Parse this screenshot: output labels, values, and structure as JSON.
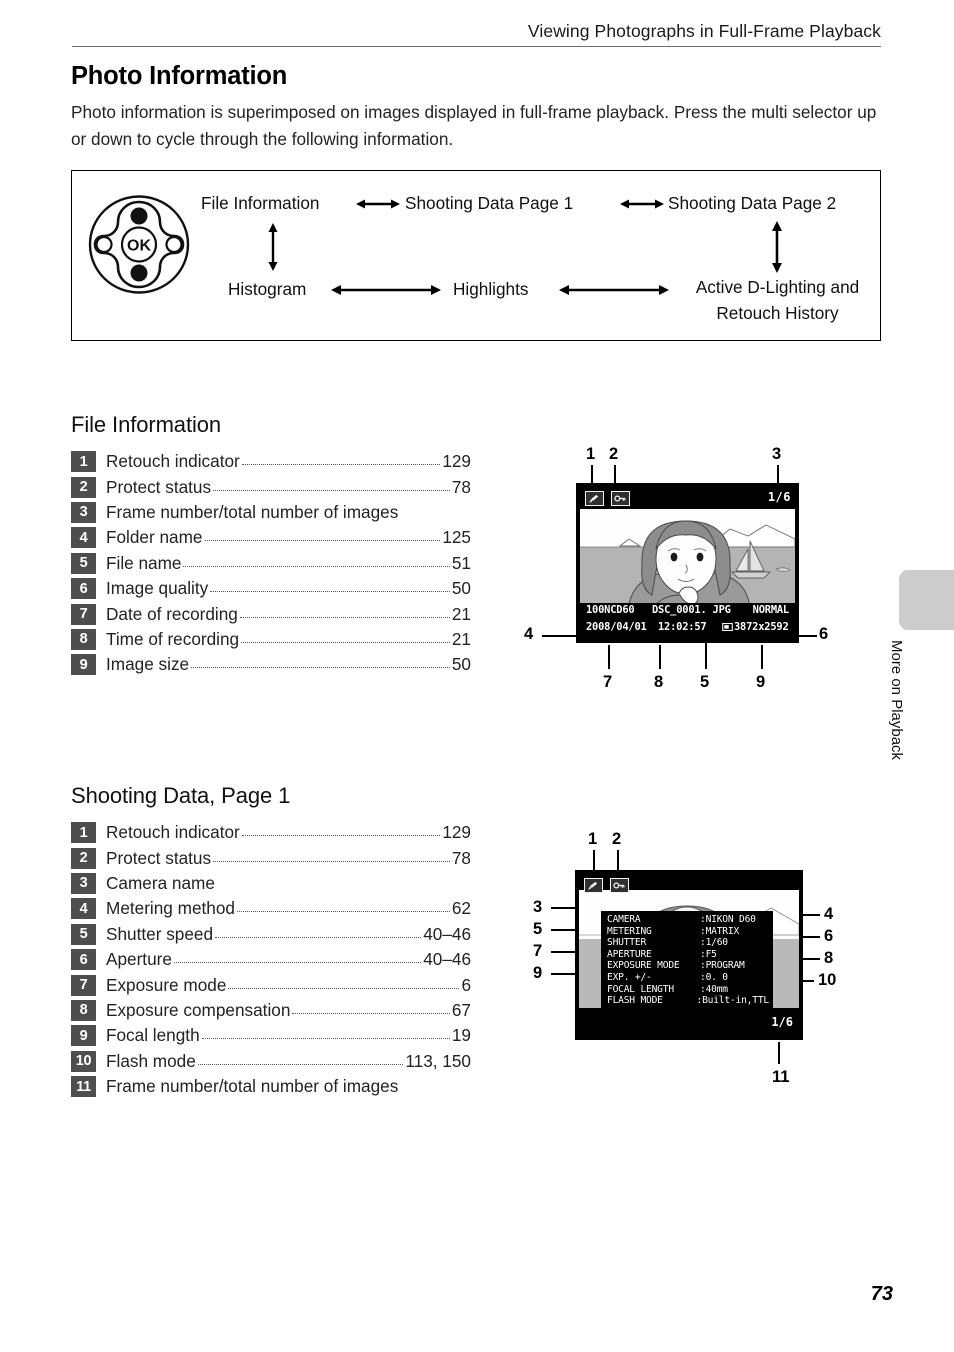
{
  "header": {
    "running_title": "Viewing Photographs in Full-Frame Playback"
  },
  "page": {
    "title": "Photo Information",
    "intro": "Photo information is superimposed on images displayed in full-frame playback. Press the multi selector up or down to cycle through the following information.",
    "number": "73"
  },
  "side_tab": {
    "label": "More on Playback"
  },
  "flow_diagram": {
    "multi_selector_ok_label": "OK",
    "nodes": {
      "file_information": "File Information",
      "shooting_data_1": "Shooting Data Page 1",
      "shooting_data_2": "Shooting Data Page 2",
      "histogram": "Histogram",
      "highlights": "Highlights",
      "active_d_lighting": "Active D-Lighting and Retouch History"
    }
  },
  "file_information": {
    "heading": "File Information",
    "items": [
      {
        "num": "1",
        "label": "Retouch indicator",
        "page": "129"
      },
      {
        "num": "2",
        "label": "Protect status",
        "page": "78"
      },
      {
        "num": "3",
        "label": "Frame number/total number of images",
        "page": ""
      },
      {
        "num": "4",
        "label": "Folder name",
        "page": "125"
      },
      {
        "num": "5",
        "label": "File name",
        "page": "51"
      },
      {
        "num": "6",
        "label": "Image quality",
        "page": "50"
      },
      {
        "num": "7",
        "label": "Date of recording",
        "page": "21"
      },
      {
        "num": "8",
        "label": "Time of recording",
        "page": "21"
      },
      {
        "num": "9",
        "label": "Image size",
        "page": "50"
      }
    ],
    "screen": {
      "frame_counter": "1/6",
      "folder_name": "100NCD60",
      "file_name": "DSC_0001. JPG",
      "quality": "NORMAL",
      "date": "2008/04/01",
      "time": "12:02:57",
      "image_size": "3872x2592",
      "callouts": [
        "1",
        "2",
        "3",
        "4",
        "5",
        "6",
        "7",
        "8",
        "9"
      ]
    }
  },
  "shooting_data": {
    "heading": "Shooting Data, Page 1",
    "items": [
      {
        "num": "1",
        "label": "Retouch indicator",
        "page": "129"
      },
      {
        "num": "2",
        "label": "Protect status",
        "page": "78"
      },
      {
        "num": "3",
        "label": "Camera name",
        "page": ""
      },
      {
        "num": "4",
        "label": "Metering method",
        "page": "62"
      },
      {
        "num": "5",
        "label": "Shutter speed",
        "page": "40–46"
      },
      {
        "num": "6",
        "label": "Aperture",
        "page": "40–46"
      },
      {
        "num": "7",
        "label": "Exposure mode",
        "page": "6"
      },
      {
        "num": "8",
        "label": "Exposure compensation",
        "page": "67"
      },
      {
        "num": "9",
        "label": "Focal length",
        "page": "19"
      },
      {
        "num": "10",
        "label": "Flash mode",
        "page": "113, 150"
      },
      {
        "num": "11",
        "label": "Frame number/total number of images",
        "page": ""
      }
    ],
    "screen": {
      "frame_counter": "1/6",
      "rows": [
        {
          "key": "CAMERA",
          "value": ":NIKON D60"
        },
        {
          "key": "METERING",
          "value": ":MATRIX"
        },
        {
          "key": "SHUTTER",
          "value": ":1/60"
        },
        {
          "key": "APERTURE",
          "value": ":F5"
        },
        {
          "key": "EXPOSURE MODE",
          "value": ":PROGRAM"
        },
        {
          "key": "EXP. +/-",
          "value": ":0. 0"
        },
        {
          "key": "FOCAL LENGTH",
          "value": ":40mm"
        },
        {
          "key": "FLASH MODE",
          "value": ":Built-in,TTL"
        }
      ],
      "callouts": [
        "1",
        "2",
        "3",
        "4",
        "5",
        "6",
        "7",
        "8",
        "9",
        "10",
        "11"
      ]
    }
  },
  "colors": {
    "badge_bg": "#4e4e4e",
    "tab_gray": "#cccccc",
    "rule": "#6e6e6e"
  }
}
